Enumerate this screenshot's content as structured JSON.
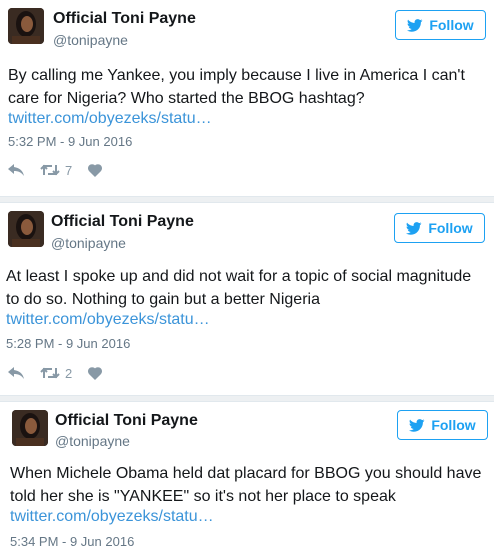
{
  "tweets": [
    {
      "name": "Official Toni Payne",
      "handle": "@tonipayne",
      "follow_label": "Follow",
      "text": "By calling me Yankee, you imply because I live in America I can't care for Nigeria? Who started the BBOG hashtag?",
      "link": "twitter.com/obyezeks/statu…",
      "timestamp": "5:32 PM - 9 Jun 2016",
      "retweet_count": "7"
    },
    {
      "name": "Official Toni Payne",
      "handle": "@tonipayne",
      "follow_label": "Follow",
      "text": "At least I spoke up and did not wait for a topic of social magnitude to do so. Nothing to gain but a better Nigeria",
      "link": "twitter.com/obyezeks/statu…",
      "timestamp": "5:28 PM - 9 Jun 2016",
      "retweet_count": "2"
    },
    {
      "name": "Official Toni Payne",
      "handle": "@tonipayne",
      "follow_label": "Follow",
      "text": "When Michele Obama held dat placard for BBOG you should have told her she is \"YANKEE\" so it's not her place to speak",
      "link": "twitter.com/obyezeks/statu…",
      "timestamp": "5:34 PM - 9 Jun 2016"
    }
  ],
  "colors": {
    "twitter_blue": "#1da1f2",
    "link_blue": "#3b94d9",
    "muted_gray": "#657786",
    "icon_gray": "#8899a6"
  },
  "icons": {
    "avatar": "profile-photo",
    "follow": "twitter-bird-icon",
    "reply": "reply-arrow-icon",
    "retweet": "retweet-icon",
    "like": "heart-icon"
  }
}
